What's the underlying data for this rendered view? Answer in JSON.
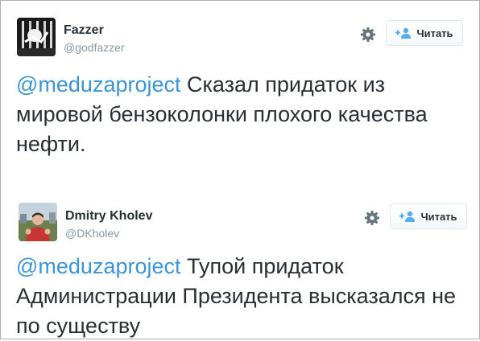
{
  "tweets": [
    {
      "name": "Fazzer",
      "handle": "@godfazzer",
      "follow_label": "Читать",
      "mention": "@meduzaproject",
      "text": " Сказал придаток из мировой бензоколонки плохого качества нефти."
    },
    {
      "name": "Dmitry Kholev",
      "handle": "@DKholev",
      "follow_label": "Читать",
      "mention": "@meduzaproject",
      "text": " Тупой придаток Администрации Президента высказался не по существу"
    }
  ],
  "colors": {
    "link": "#3b94d9",
    "text": "#292f33",
    "handle": "#8899a6",
    "follow_icon": "#55acee"
  },
  "icons": [
    "gear-icon",
    "follow-user-icon"
  ]
}
